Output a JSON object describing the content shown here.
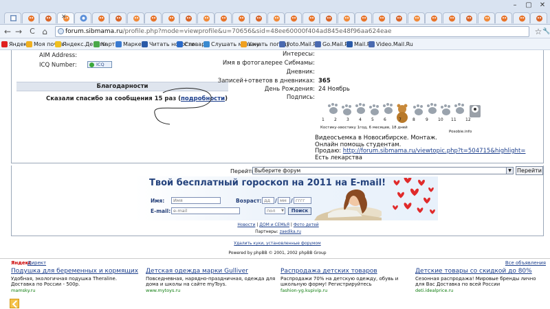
{
  "browser": {
    "url_host": "forum.sibmama.ru",
    "url_rest": "/profile.php?mode=viewprofile&u=70656&sid=48ee60000f404ad845e48f96aa624eae",
    "bookmarks": [
      "Яндекс",
      "Моя почта",
      "Яндекс.Деньги",
      "Карты",
      "Маркет",
      "Читать новости",
      "Словари",
      "Слушать музыку",
      "Узнать погоду",
      "Foto.Mail.Ru",
      "Go.Mail.Ru",
      "Mail.Ru",
      "Video.Mail.Ru"
    ],
    "star": "☆",
    "wrench": "🔧"
  },
  "profile": {
    "aim_label": "AIM Address:",
    "icq_label": "ICQ Number:",
    "icq_badge": "ICQ",
    "interests_label": "Интересы:",
    "gallery_label": "Имя в фотогалерее Сибмамы:",
    "diary_label": "Дневник:",
    "posts_label": "Записей+ответов в дневниках:",
    "posts_value": "365",
    "birthday_label": "День Рождения:",
    "birthday_value": "24 Ноябрь",
    "signature_label": "Подпись:"
  },
  "thanks": {
    "header": "Благодарности",
    "text": "Сказали спасибо за сообщения 15 раз (",
    "link": "подробности",
    "close": ")"
  },
  "signature": {
    "numbers": [
      "1",
      "2",
      "3",
      "4",
      "5",
      "6",
      "7",
      "8",
      "9",
      "10",
      "11",
      "12"
    ],
    "caption_left": "Костику-хвостику 1год, 6 месяцев, 18 дней",
    "caption_right": "Posobie.info",
    "line1": "Видеосъемка в Новосибирске. Монтаж.",
    "line2": "Онлайн помощь студентам.",
    "line3_prefix": "Продаю: ",
    "line3_link": "http://forum.sibmama.ru/viewtopic.php?t=504715&highlight=",
    "line4": "Есть лекарства"
  },
  "jump": {
    "label": "Перейти:",
    "selected": "Выберите форум",
    "button": "Перейти"
  },
  "banner": {
    "title": "Твой бесплатный гороскоп на 2011 на E-mail!",
    "name_label": "Имя:",
    "name_placeholder": "Имя",
    "age_label": "Возраст:",
    "dd": "дд",
    "mm": "мм",
    "yyyy": "гггг",
    "email_label": "E-mail:",
    "email_placeholder": "e-mail",
    "gender": "пол",
    "search_button": "Поиск"
  },
  "footer": {
    "news": "Новости",
    "home_family": "ДОМ и СЕМЬЯ",
    "photo": "Фото детей",
    "partners_label": "Партнеры:",
    "partner": "zaedika.ru",
    "delete_cookies": "Удалить куки, установленные форумом",
    "powered": "Powered by phpBB © 2001, 2002 phpBB Group"
  },
  "ads": {
    "yandex": "Яндекс",
    "direct": "Директ",
    "all": "Все объявления",
    "items": [
      {
        "title": "Подушка для беременных и кормящих",
        "desc": "Удобная, экологичная подушка Theraline. Доставка по России - 500р.",
        "url": "mamsky.ru"
      },
      {
        "title": "Детская одежда марки Gulliver",
        "desc": "Повседневная, нарядно-праздничная, одежда для дома и школы на сайте myToys.",
        "url": "www.mytoys.ru"
      },
      {
        "title": "Распродажа детских товаров",
        "desc": "Распродажи 70% на детскую одежду, обувь и школьную форму! Регистрируйтесь",
        "url": "fashion-yg.kupivip.ru"
      },
      {
        "title": "Детские товары со скидкой до 80%",
        "desc": "Сезонная распродажа! Мировые бренды лично для Вас Доставка по всей России",
        "url": "deti.idealprice.ru"
      }
    ]
  }
}
